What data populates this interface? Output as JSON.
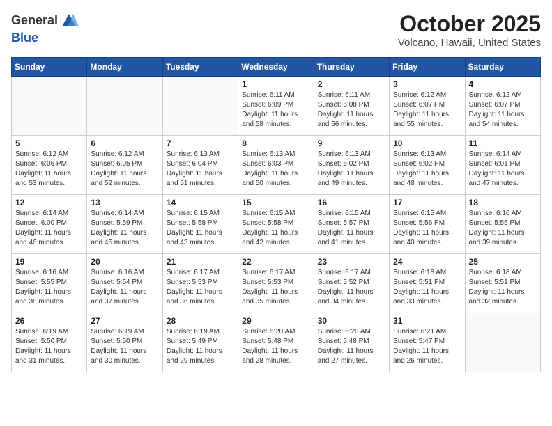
{
  "header": {
    "logo_line1": "General",
    "logo_line2": "Blue",
    "month_title": "October 2025",
    "location": "Volcano, Hawaii, United States"
  },
  "weekdays": [
    "Sunday",
    "Monday",
    "Tuesday",
    "Wednesday",
    "Thursday",
    "Friday",
    "Saturday"
  ],
  "weeks": [
    [
      {
        "day": "",
        "info": ""
      },
      {
        "day": "",
        "info": ""
      },
      {
        "day": "",
        "info": ""
      },
      {
        "day": "1",
        "info": "Sunrise: 6:11 AM\nSunset: 6:09 PM\nDaylight: 11 hours\nand 58 minutes."
      },
      {
        "day": "2",
        "info": "Sunrise: 6:11 AM\nSunset: 6:08 PM\nDaylight: 11 hours\nand 56 minutes."
      },
      {
        "day": "3",
        "info": "Sunrise: 6:12 AM\nSunset: 6:07 PM\nDaylight: 11 hours\nand 55 minutes."
      },
      {
        "day": "4",
        "info": "Sunrise: 6:12 AM\nSunset: 6:07 PM\nDaylight: 11 hours\nand 54 minutes."
      }
    ],
    [
      {
        "day": "5",
        "info": "Sunrise: 6:12 AM\nSunset: 6:06 PM\nDaylight: 11 hours\nand 53 minutes."
      },
      {
        "day": "6",
        "info": "Sunrise: 6:12 AM\nSunset: 6:05 PM\nDaylight: 11 hours\nand 52 minutes."
      },
      {
        "day": "7",
        "info": "Sunrise: 6:13 AM\nSunset: 6:04 PM\nDaylight: 11 hours\nand 51 minutes."
      },
      {
        "day": "8",
        "info": "Sunrise: 6:13 AM\nSunset: 6:03 PM\nDaylight: 11 hours\nand 50 minutes."
      },
      {
        "day": "9",
        "info": "Sunrise: 6:13 AM\nSunset: 6:02 PM\nDaylight: 11 hours\nand 49 minutes."
      },
      {
        "day": "10",
        "info": "Sunrise: 6:13 AM\nSunset: 6:02 PM\nDaylight: 11 hours\nand 48 minutes."
      },
      {
        "day": "11",
        "info": "Sunrise: 6:14 AM\nSunset: 6:01 PM\nDaylight: 11 hours\nand 47 minutes."
      }
    ],
    [
      {
        "day": "12",
        "info": "Sunrise: 6:14 AM\nSunset: 6:00 PM\nDaylight: 11 hours\nand 46 minutes."
      },
      {
        "day": "13",
        "info": "Sunrise: 6:14 AM\nSunset: 5:59 PM\nDaylight: 11 hours\nand 45 minutes."
      },
      {
        "day": "14",
        "info": "Sunrise: 6:15 AM\nSunset: 5:58 PM\nDaylight: 11 hours\nand 43 minutes."
      },
      {
        "day": "15",
        "info": "Sunrise: 6:15 AM\nSunset: 5:58 PM\nDaylight: 11 hours\nand 42 minutes."
      },
      {
        "day": "16",
        "info": "Sunrise: 6:15 AM\nSunset: 5:57 PM\nDaylight: 11 hours\nand 41 minutes."
      },
      {
        "day": "17",
        "info": "Sunrise: 6:15 AM\nSunset: 5:56 PM\nDaylight: 11 hours\nand 40 minutes."
      },
      {
        "day": "18",
        "info": "Sunrise: 6:16 AM\nSunset: 5:55 PM\nDaylight: 11 hours\nand 39 minutes."
      }
    ],
    [
      {
        "day": "19",
        "info": "Sunrise: 6:16 AM\nSunset: 5:55 PM\nDaylight: 11 hours\nand 38 minutes."
      },
      {
        "day": "20",
        "info": "Sunrise: 6:16 AM\nSunset: 5:54 PM\nDaylight: 11 hours\nand 37 minutes."
      },
      {
        "day": "21",
        "info": "Sunrise: 6:17 AM\nSunset: 5:53 PM\nDaylight: 11 hours\nand 36 minutes."
      },
      {
        "day": "22",
        "info": "Sunrise: 6:17 AM\nSunset: 5:53 PM\nDaylight: 11 hours\nand 35 minutes."
      },
      {
        "day": "23",
        "info": "Sunrise: 6:17 AM\nSunset: 5:52 PM\nDaylight: 11 hours\nand 34 minutes."
      },
      {
        "day": "24",
        "info": "Sunrise: 6:18 AM\nSunset: 5:51 PM\nDaylight: 11 hours\nand 33 minutes."
      },
      {
        "day": "25",
        "info": "Sunrise: 6:18 AM\nSunset: 5:51 PM\nDaylight: 11 hours\nand 32 minutes."
      }
    ],
    [
      {
        "day": "26",
        "info": "Sunrise: 6:19 AM\nSunset: 5:50 PM\nDaylight: 11 hours\nand 31 minutes."
      },
      {
        "day": "27",
        "info": "Sunrise: 6:19 AM\nSunset: 5:50 PM\nDaylight: 11 hours\nand 30 minutes."
      },
      {
        "day": "28",
        "info": "Sunrise: 6:19 AM\nSunset: 5:49 PM\nDaylight: 11 hours\nand 29 minutes."
      },
      {
        "day": "29",
        "info": "Sunrise: 6:20 AM\nSunset: 5:48 PM\nDaylight: 11 hours\nand 28 minutes."
      },
      {
        "day": "30",
        "info": "Sunrise: 6:20 AM\nSunset: 5:48 PM\nDaylight: 11 hours\nand 27 minutes."
      },
      {
        "day": "31",
        "info": "Sunrise: 6:21 AM\nSunset: 5:47 PM\nDaylight: 11 hours\nand 26 minutes."
      },
      {
        "day": "",
        "info": ""
      }
    ]
  ]
}
